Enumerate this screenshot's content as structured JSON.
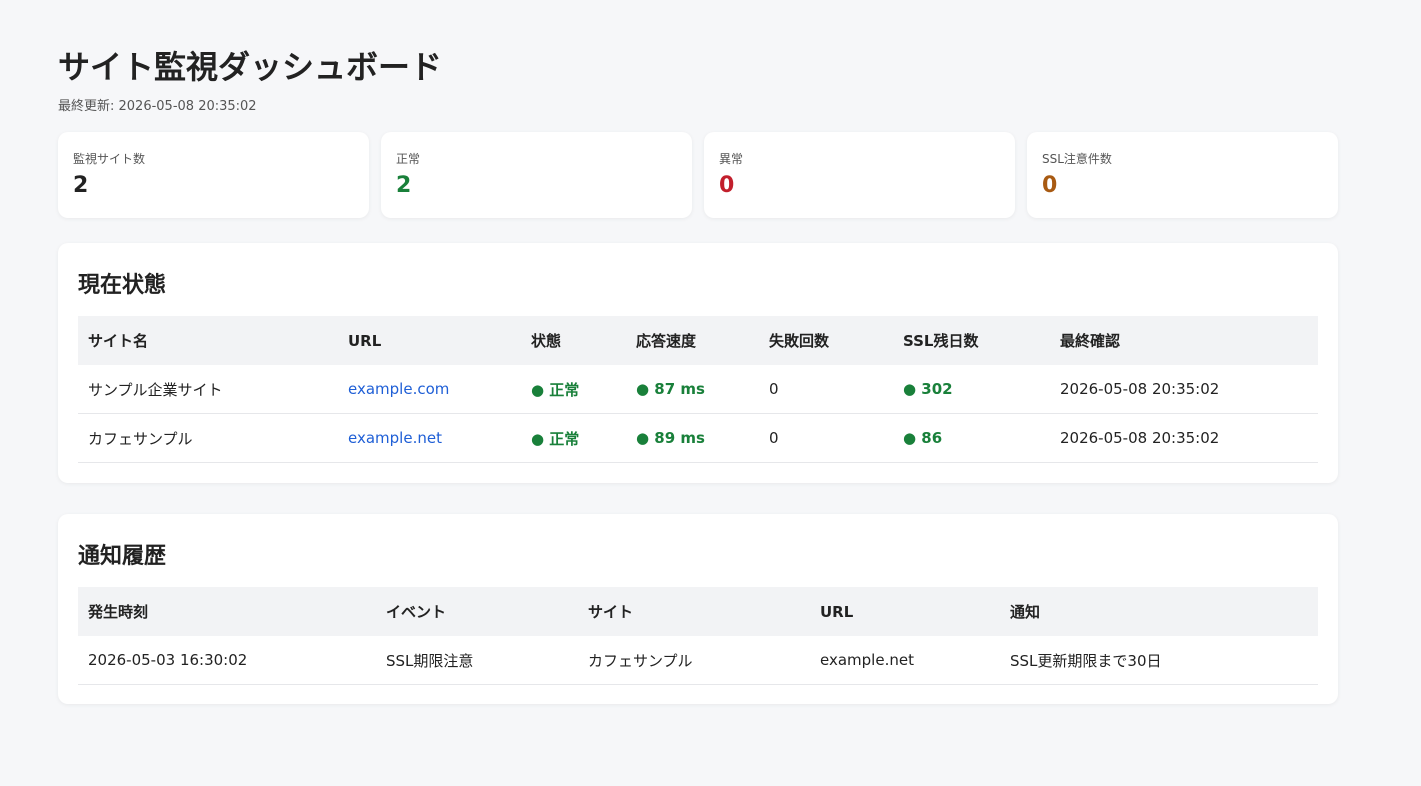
{
  "header": {
    "title": "サイト監視ダッシュボード",
    "updated_label": "最終更新: 2026-05-08 20:35:02"
  },
  "stats": [
    {
      "label": "監視サイト数",
      "value": "2",
      "color": "#222222"
    },
    {
      "label": "正常",
      "value": "2",
      "color": "#19803a"
    },
    {
      "label": "異常",
      "value": "0",
      "color": "#c21f2c"
    },
    {
      "label": "SSL注意件数",
      "value": "0",
      "color": "#a85a12"
    }
  ],
  "current": {
    "title": "現在状態",
    "headers": [
      "サイト名",
      "URL",
      "状態",
      "応答速度",
      "失敗回数",
      "SSL残日数",
      "最終確認"
    ],
    "rows": [
      {
        "name": "サンプル企業サイト",
        "url": "example.com",
        "status": "● 正常",
        "response": "● 87 ms",
        "failures": "0",
        "ssl_days": "● 302",
        "last_checked": "2026-05-08 20:35:02"
      },
      {
        "name": "カフェサンプル",
        "url": "example.net",
        "status": "● 正常",
        "response": "● 89 ms",
        "failures": "0",
        "ssl_days": "● 86",
        "last_checked": "2026-05-08 20:35:02"
      }
    ]
  },
  "history": {
    "title": "通知履歴",
    "headers": [
      "発生時刻",
      "イベント",
      "サイト",
      "URL",
      "通知"
    ],
    "rows": [
      {
        "time": "2026-05-03 16:30:02",
        "event": "SSL期限注意",
        "site": "カフェサンプル",
        "url": "example.net",
        "notice": "SSL更新期限まで30日"
      }
    ]
  },
  "colors": {
    "ok": "#19803a",
    "link": "#1f5fd6"
  }
}
